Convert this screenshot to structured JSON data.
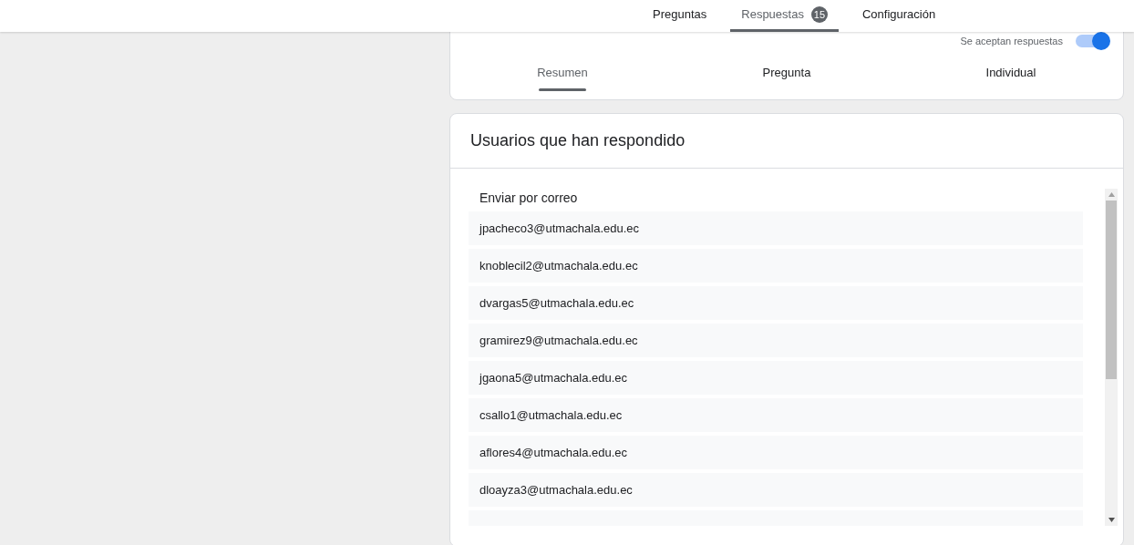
{
  "top_tabs": [
    {
      "label": "Preguntas",
      "selected": false
    },
    {
      "label": "Respuestas",
      "selected": true,
      "count": "15"
    },
    {
      "label": "Configuración",
      "selected": false
    }
  ],
  "accepting": {
    "label": "Se aceptan respuestas",
    "on": true
  },
  "view_tabs": [
    {
      "label": "Resumen",
      "selected": true
    },
    {
      "label": "Pregunta",
      "selected": false
    },
    {
      "label": "Individual",
      "selected": false
    }
  ],
  "respondents": {
    "title": "Usuarios que han respondido",
    "email_label": "Enviar por correo",
    "emails": [
      "jpacheco3@utmachala.edu.ec",
      "knoblecil2@utmachala.edu.ec",
      "dvargas5@utmachala.edu.ec",
      "gramirez9@utmachala.edu.ec",
      "jgaona5@utmachala.edu.ec",
      "csallo1@utmachala.edu.ec",
      "aflores4@utmachala.edu.ec",
      "dloayza3@utmachala.edu.ec"
    ]
  }
}
